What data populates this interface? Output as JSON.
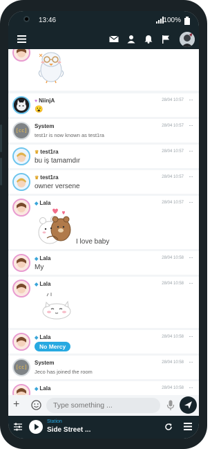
{
  "status_bar": {
    "time": "13:46",
    "battery": "100%"
  },
  "messages": [
    {
      "user": "",
      "time": "",
      "text": "",
      "sticker": "bird-sticker"
    },
    {
      "user": "NiinjA",
      "time": "28/04 10:57",
      "text": "😮"
    },
    {
      "user": "System",
      "time": "28/04 10:57",
      "text": "test1r is now known as test1ra"
    },
    {
      "user": "test1ra",
      "time": "28/04 10:57",
      "text": "bu iş tamamdır"
    },
    {
      "user": "test1ra",
      "time": "28/04 10:57",
      "text": "owner versene"
    },
    {
      "user": "Lala",
      "time": "28/04 10:57",
      "text": "I love baby",
      "sticker": "bears-hug-sticker"
    },
    {
      "user": "Lala",
      "time": "28/04 10:58",
      "text": "My"
    },
    {
      "user": "Lala",
      "time": "28/04 10:58",
      "text": "",
      "sticker": "cat-sticker"
    },
    {
      "user": "Lala",
      "time": "28/04 10:58",
      "text": "No Mercy"
    },
    {
      "user": "System",
      "time": "28/04 10:58",
      "text": "Jeco has joined the room"
    },
    {
      "user": "Lala",
      "time": "28/04 10:58",
      "text": ""
    }
  ],
  "composer": {
    "placeholder": "Type something ..."
  },
  "player": {
    "label": "Station",
    "name": "Side Street ..."
  },
  "system_avatar_text": "[cc]",
  "more_glyph": "···",
  "colors": {
    "bar": "#17252b",
    "accent": "#27a9e1",
    "pink_ring": "#e89ad0",
    "blue_ring": "#6cc4ec"
  }
}
